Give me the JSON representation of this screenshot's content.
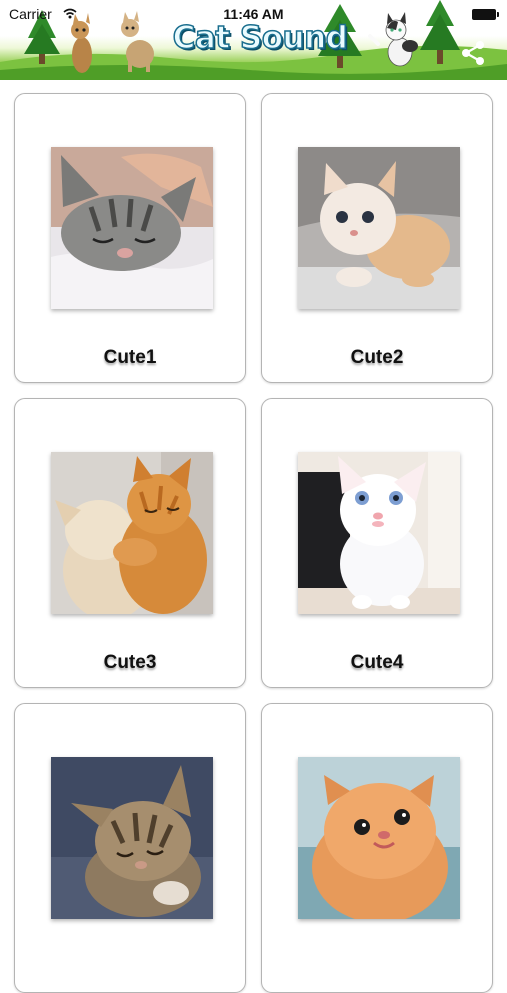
{
  "status_bar": {
    "carrier": "Carrier",
    "time": "11:46 AM"
  },
  "header": {
    "title": "Cat Sound",
    "share_icon": "share-icon"
  },
  "cards": [
    {
      "label": "Cute1",
      "photo": "gray-tabby-kitten-sleeping"
    },
    {
      "label": "Cute2",
      "photo": "cream-white-kitten-on-fur"
    },
    {
      "label": "Cute3",
      "photo": "two-kittens-hugging"
    },
    {
      "label": "Cute4",
      "photo": "white-kitten-blue-eyes"
    },
    {
      "label": "",
      "photo": "tabby-kitten-eyes-closed"
    },
    {
      "label": "",
      "photo": "orange-persian-kitten"
    }
  ]
}
